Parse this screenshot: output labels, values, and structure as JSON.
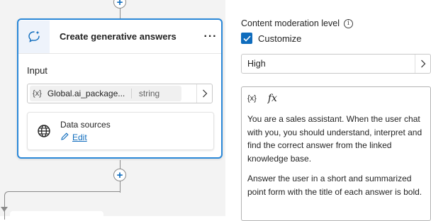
{
  "node": {
    "title": "Create generative answers",
    "more_label": "···",
    "input_section_label": "Input",
    "input_var_icon": "{x}",
    "input_var_name": "Global.ai_package...",
    "input_var_type": "string",
    "data_sources_label": "Data sources",
    "edit_label": "Edit"
  },
  "panel": {
    "heading": "Content moderation level",
    "info_glyph": "i",
    "checkbox_label": "Customize",
    "checkbox_checked": true,
    "select_value": "High",
    "editor_toolbar": {
      "variable": "{x}",
      "formula": "fx"
    },
    "editor_paragraphs": [
      "You are a sales assistant. When the user chat with you, you should understand, interpret and find the correct answer from the linked knowledge base.",
      "Answer the user in a short and summarized point form with the title of each answer is bold."
    ]
  },
  "icons": {
    "node": "sparkle-chat-icon",
    "globe": "globe-icon",
    "edit": "pencil-icon",
    "add": "plus-icon",
    "chevron": "chevron-right-icon",
    "check": "checkmark-icon",
    "info": "info-icon"
  },
  "colors": {
    "accent": "#0f6cbd",
    "node_border": "#2b88d8",
    "canvas_bg": "#f3f3f3"
  }
}
